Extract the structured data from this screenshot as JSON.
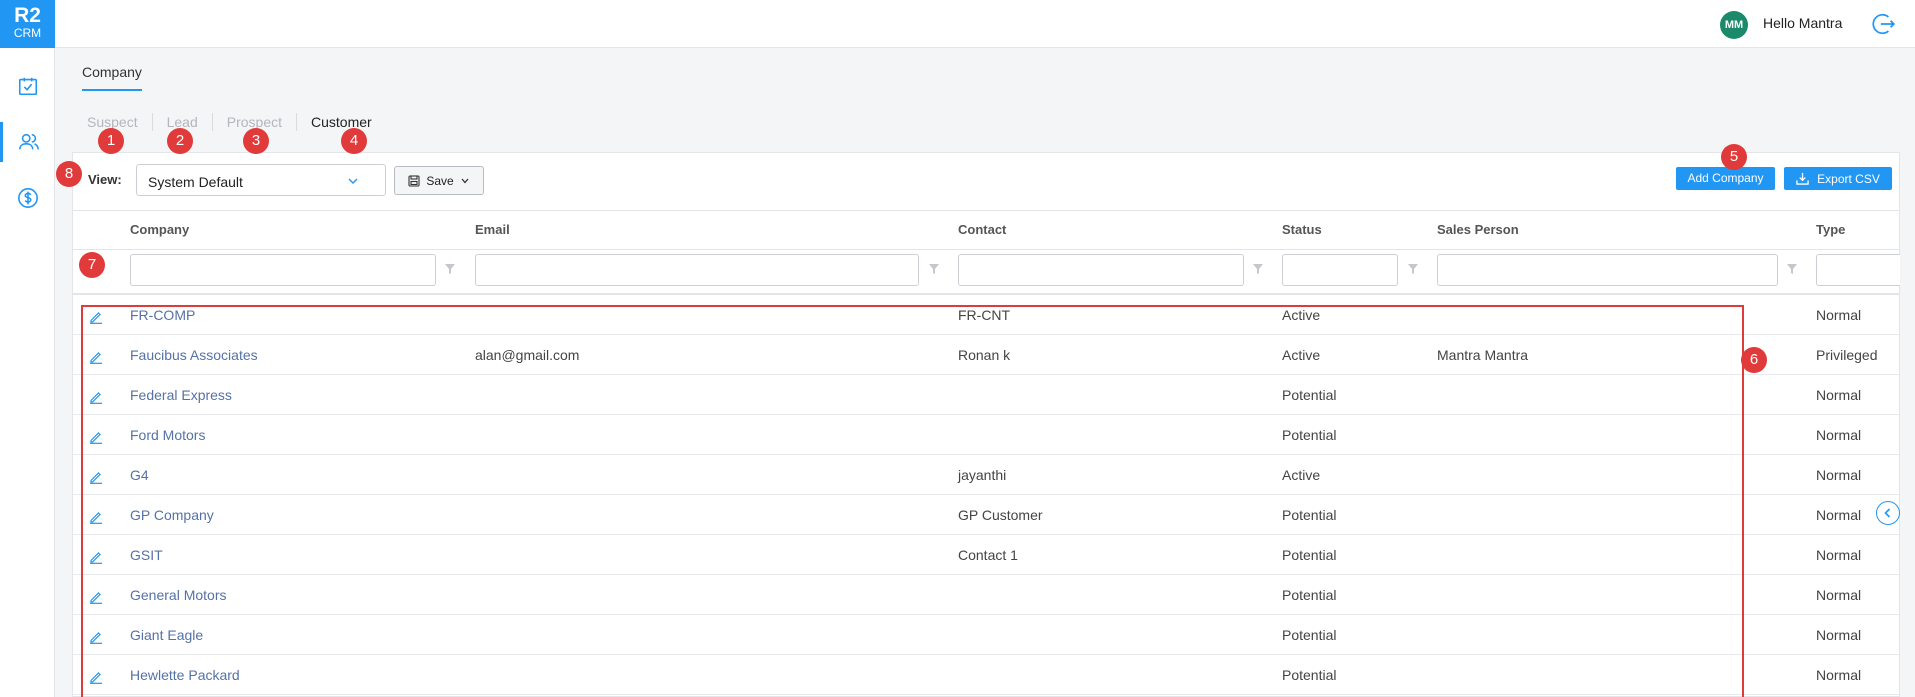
{
  "app": {
    "logo_line1": "R2",
    "logo_line2": "CRM"
  },
  "sidebar": {
    "items": [
      {
        "icon": "calendar-check-icon"
      },
      {
        "icon": "users-icon",
        "active": true
      },
      {
        "icon": "dollar-icon"
      }
    ]
  },
  "topbar": {
    "avatar_initials": "MM",
    "greeting": "Hello Mantra",
    "logout_icon": "logout-icon"
  },
  "page": {
    "tab": "Company"
  },
  "stages": [
    "Suspect",
    "Lead",
    "Prospect",
    "Customer"
  ],
  "badges": [
    "1",
    "2",
    "3",
    "4",
    "5",
    "6",
    "7",
    "8"
  ],
  "toolbar": {
    "view_label": "View:",
    "view_value": "System Default",
    "save_label": "Save",
    "add_label": "Add Company",
    "export_label": "Export CSV"
  },
  "columns": [
    "Company",
    "Email",
    "Contact",
    "Status",
    "Sales Person",
    "Type"
  ],
  "rows": [
    {
      "company": "FR-COMP",
      "email": "",
      "contact": "FR-CNT",
      "status": "Active",
      "sales_person": "",
      "type": "Normal"
    },
    {
      "company": "Faucibus Associates",
      "email": "alan@gmail.com",
      "contact": "Ronan k",
      "status": "Active",
      "sales_person": "Mantra Mantra",
      "type": "Privileged"
    },
    {
      "company": "Federal Express",
      "email": "",
      "contact": "",
      "status": "Potential",
      "sales_person": "",
      "type": "Normal"
    },
    {
      "company": "Ford Motors",
      "email": "",
      "contact": "",
      "status": "Potential",
      "sales_person": "",
      "type": "Normal"
    },
    {
      "company": "G4",
      "email": "",
      "contact": "jayanthi",
      "status": "Active",
      "sales_person": "",
      "type": "Normal"
    },
    {
      "company": "GP Company",
      "email": "",
      "contact": "GP Customer",
      "status": "Potential",
      "sales_person": "",
      "type": "Normal"
    },
    {
      "company": "GSIT",
      "email": "",
      "contact": "Contact 1",
      "status": "Potential",
      "sales_person": "",
      "type": "Normal"
    },
    {
      "company": "General Motors",
      "email": "",
      "contact": "",
      "status": "Potential",
      "sales_person": "",
      "type": "Normal"
    },
    {
      "company": "Giant Eagle",
      "email": "",
      "contact": "",
      "status": "Potential",
      "sales_person": "",
      "type": "Normal"
    },
    {
      "company": "Hewlette Packard",
      "email": "",
      "contact": "",
      "status": "Potential",
      "sales_person": "",
      "type": "Normal"
    }
  ],
  "colors": {
    "accent": "#2196f3",
    "badge": "#e03a3a",
    "avatar": "#1b8a6b",
    "link": "#5572a6"
  }
}
